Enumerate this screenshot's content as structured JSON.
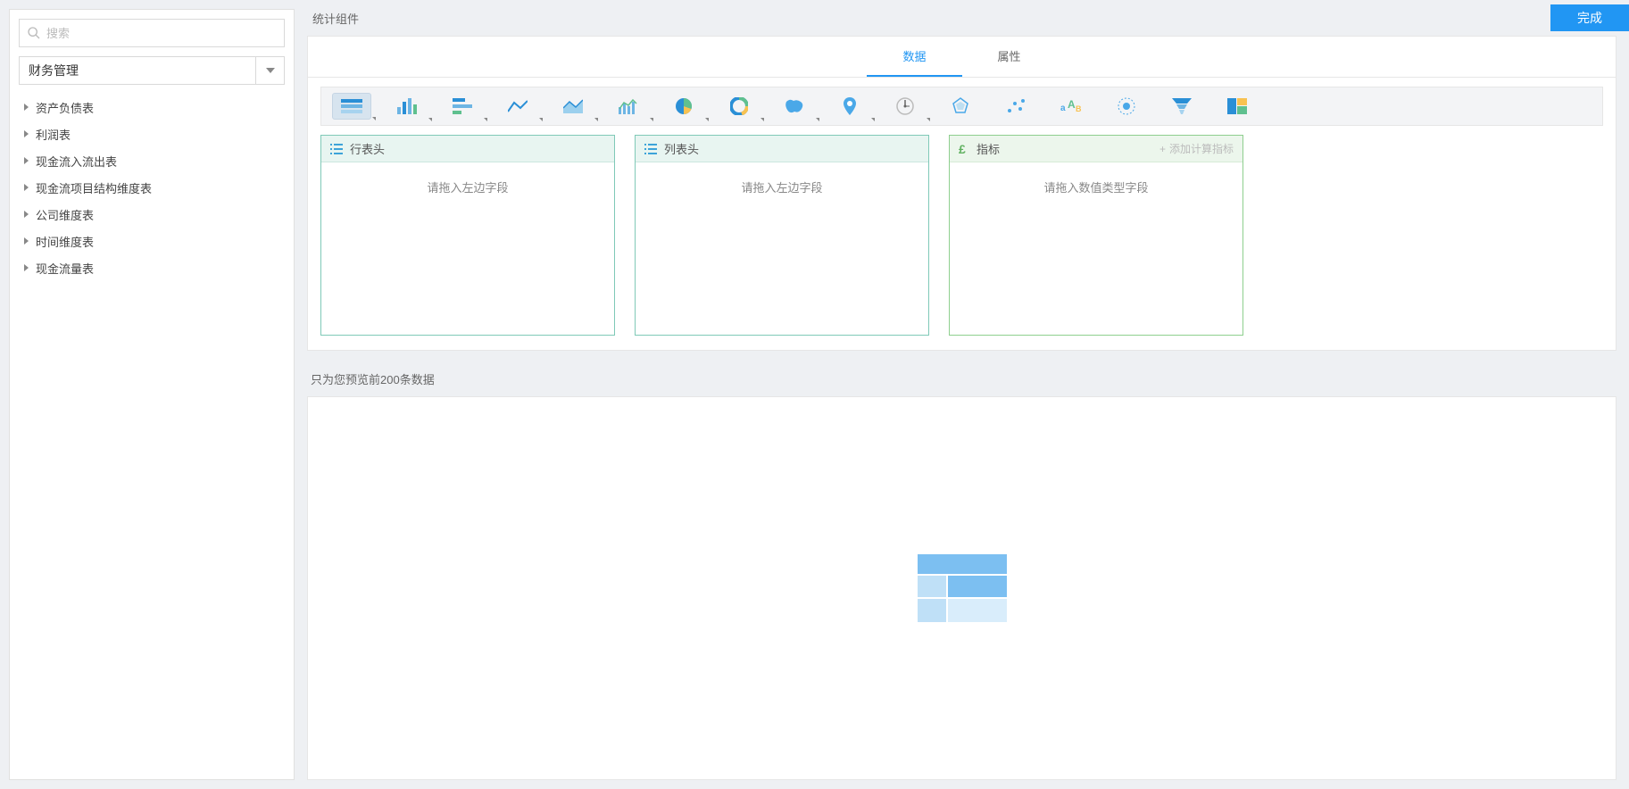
{
  "sidebar": {
    "search_placeholder": "搜索",
    "module_select": "财务管理",
    "tree": [
      "资产负债表",
      "利润表",
      "现金流入流出表",
      "现金流项目结构维度表",
      "公司维度表",
      "时间维度表",
      "现金流量表"
    ]
  },
  "topbar": {
    "title": "统计组件",
    "done": "完成"
  },
  "tabs": {
    "data": "数据",
    "attr": "属性"
  },
  "zones": {
    "row_header": "行表头",
    "col_header": "列表头",
    "metric": "指标",
    "add_calc": "添加计算指标",
    "drag_hint_field": "请拖入左边字段",
    "drag_hint_numeric": "请拖入数值类型字段"
  },
  "preview": {
    "hint": "只为您预览前200条数据"
  },
  "chart_types": [
    "table",
    "bar",
    "hbar",
    "line",
    "area",
    "combo",
    "pie",
    "donut",
    "map",
    "bubble-map",
    "gauge",
    "radar",
    "scatter",
    "word",
    "kpi",
    "funnel",
    "treemap"
  ]
}
